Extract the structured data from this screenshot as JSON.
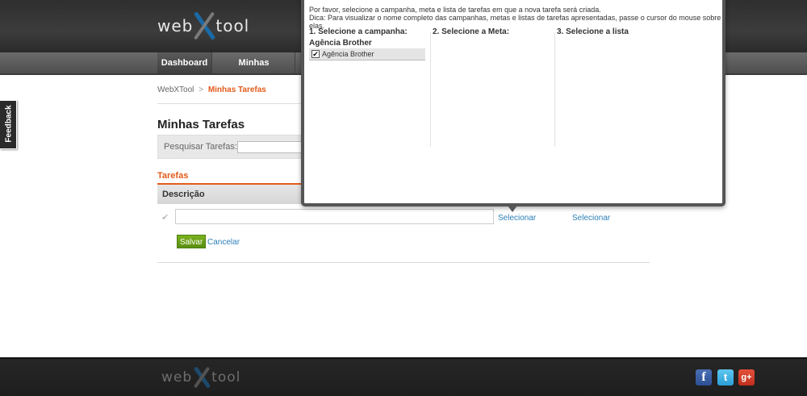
{
  "header": {
    "logo_left": "web",
    "logo_right": "tool",
    "nav": [
      {
        "label": "Dashboard"
      },
      {
        "label": "Minhas Campanhas"
      }
    ]
  },
  "breadcrumb": {
    "root": "WebXTool",
    "separator": ">",
    "current": "Minhas Tarefas"
  },
  "page": {
    "title": "Minhas Tarefas",
    "search_label": "Pesquisar Tarefas:",
    "search_value": "",
    "tab_label": "Tarefas",
    "column_description": "Descrição",
    "new_task_value": "",
    "select_meta_link": "Selecionar",
    "select_list_link": "Selecionar",
    "save_label": "Salvar",
    "cancel_label": "Cancelar"
  },
  "feedback": {
    "label": "Feedback"
  },
  "popup": {
    "instruction_line1": "Por favor, selecione a campanha, meta e lista de tarefas em que a nova tarefa será criada.",
    "instruction_line2": "Dica: Para visualizar o nome completo das campanhas, metas e listas de tarefas apresentadas, passe o cursor do mouse sobre elas.",
    "columns": [
      {
        "label": "1. Selecione a campanha:"
      },
      {
        "label": "2. Selecione a Meta:"
      },
      {
        "label": "3. Selecione a lista"
      }
    ],
    "group_label": "Agência Brother",
    "campaigns": [
      {
        "name": "Agência Brother",
        "checked": true
      }
    ]
  },
  "footer": {
    "logo_left": "web",
    "logo_right": "tool",
    "social": [
      {
        "icon": "facebook-icon",
        "glyph": "f",
        "color": "#3b5998"
      },
      {
        "icon": "twitter-icon",
        "glyph": "t",
        "color": "#33b5e5"
      },
      {
        "icon": "google-plus-icon",
        "glyph": "g+",
        "color": "#d34836"
      }
    ]
  }
}
